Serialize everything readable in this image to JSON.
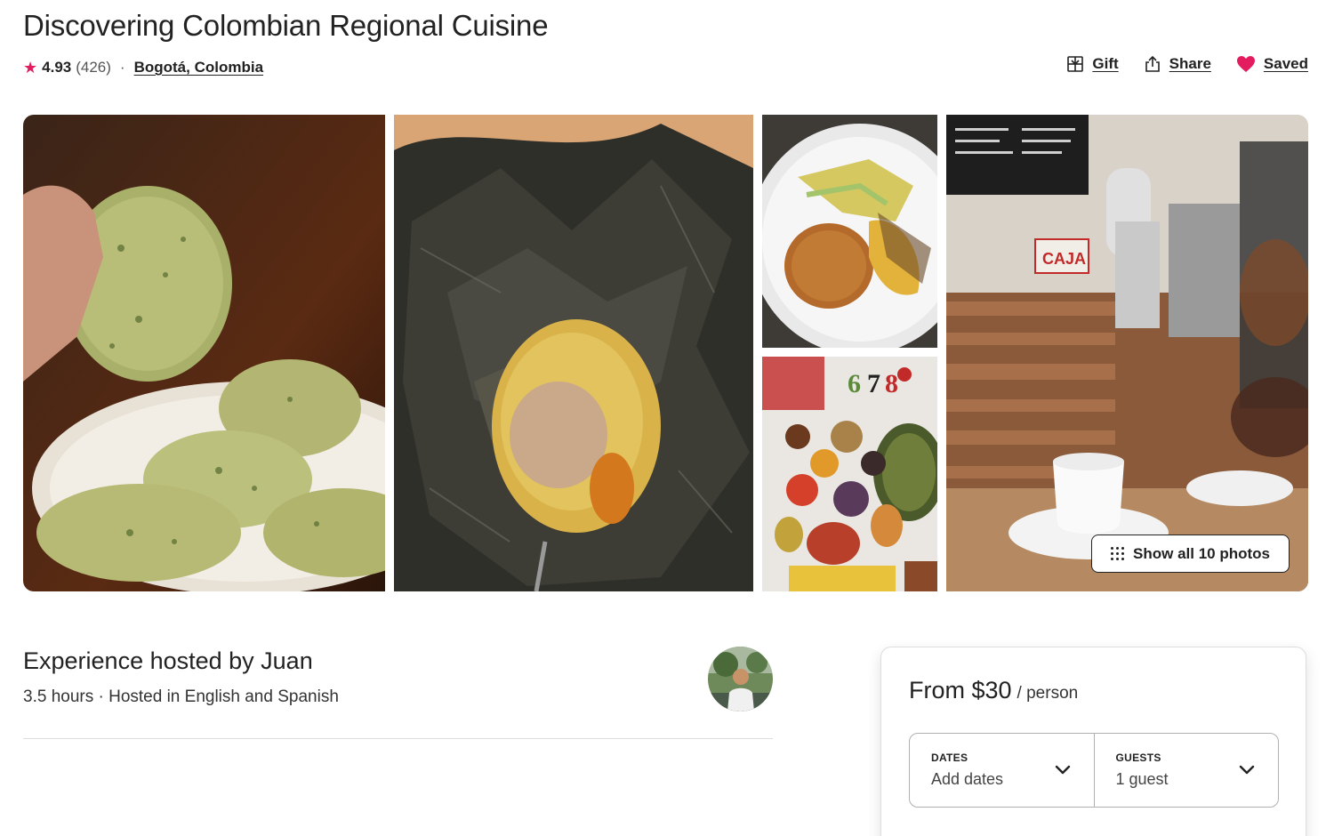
{
  "listing": {
    "title": "Discovering Colombian Regional Cuisine",
    "rating": "4.93",
    "reviews": "(426)",
    "separator": "·",
    "location": "Bogotá, Colombia"
  },
  "actions": {
    "gift": "Gift",
    "share": "Share",
    "saved": "Saved"
  },
  "gallery": {
    "photos": [
      "arepas-plate",
      "leaf-wrapped-tamal",
      "rice-plate",
      "tropical-fruits",
      "cafe-counter"
    ],
    "show_all_label": "Show all 10 photos"
  },
  "host": {
    "title": "Experience hosted by Juan",
    "details": "3.5 hours · Hosted in English and Spanish"
  },
  "booking": {
    "price": "From $30",
    "per": "/ person",
    "dates_label": "DATES",
    "dates_value": "Add dates",
    "guests_label": "GUESTS",
    "guests_value": "1 guest"
  },
  "colors": {
    "accent": "#E31C5F",
    "text": "#222222",
    "border": "#DDDDDD"
  },
  "icons": {
    "rating": "star-icon",
    "gift": "gift-icon",
    "share": "share-icon",
    "saved": "heart-icon",
    "show_all": "grid-dots-icon",
    "dropdown": "chevron-down-icon"
  }
}
